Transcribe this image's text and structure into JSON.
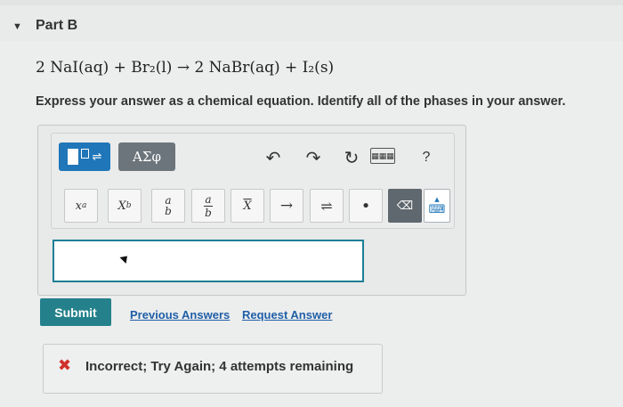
{
  "part": {
    "toggle_icon": "triangle-down-icon",
    "title": "Part B"
  },
  "question": {
    "equation": "2 NaI(aq) + Br₂(l) → 2 NaBr(aq) + I₂(s)",
    "instruction": "Express your answer as a chemical equation. Identify all of the phases in your answer."
  },
  "toolbar": {
    "templates_icon": "templates-icon",
    "greek_label": "ΑΣφ",
    "undo_icon": "undo-icon",
    "redo_icon": "redo-icon",
    "reset_icon": "reset-icon",
    "keyboard_icon": "keyboard-icon",
    "help_label": "?"
  },
  "palette": {
    "superscript": {
      "base": "x",
      "exp": "a"
    },
    "subscript": {
      "base": "X",
      "sub": "b"
    },
    "fraction": {
      "num": "a",
      "den": "b"
    },
    "fraction_mixed": {
      "num": "a",
      "den": "b"
    },
    "overbar": "X",
    "arrow": "→",
    "equilibrium": "⇌",
    "dot": "•",
    "delete_icon": "⌫",
    "keyboard_glyph": "⌨"
  },
  "actions": {
    "submit_label": "Submit",
    "previous_answers_label": "Previous Answers",
    "request_answer_label": "Request Answer"
  },
  "feedback": {
    "icon": "x-icon",
    "text": "Incorrect; Try Again; 4 attempts remaining",
    "color": "#d0312d"
  },
  "colors": {
    "primary_blue": "#1f76b8",
    "submit_teal": "#24818b",
    "input_border": "#1d7f94",
    "link": "#1f5fa8"
  }
}
